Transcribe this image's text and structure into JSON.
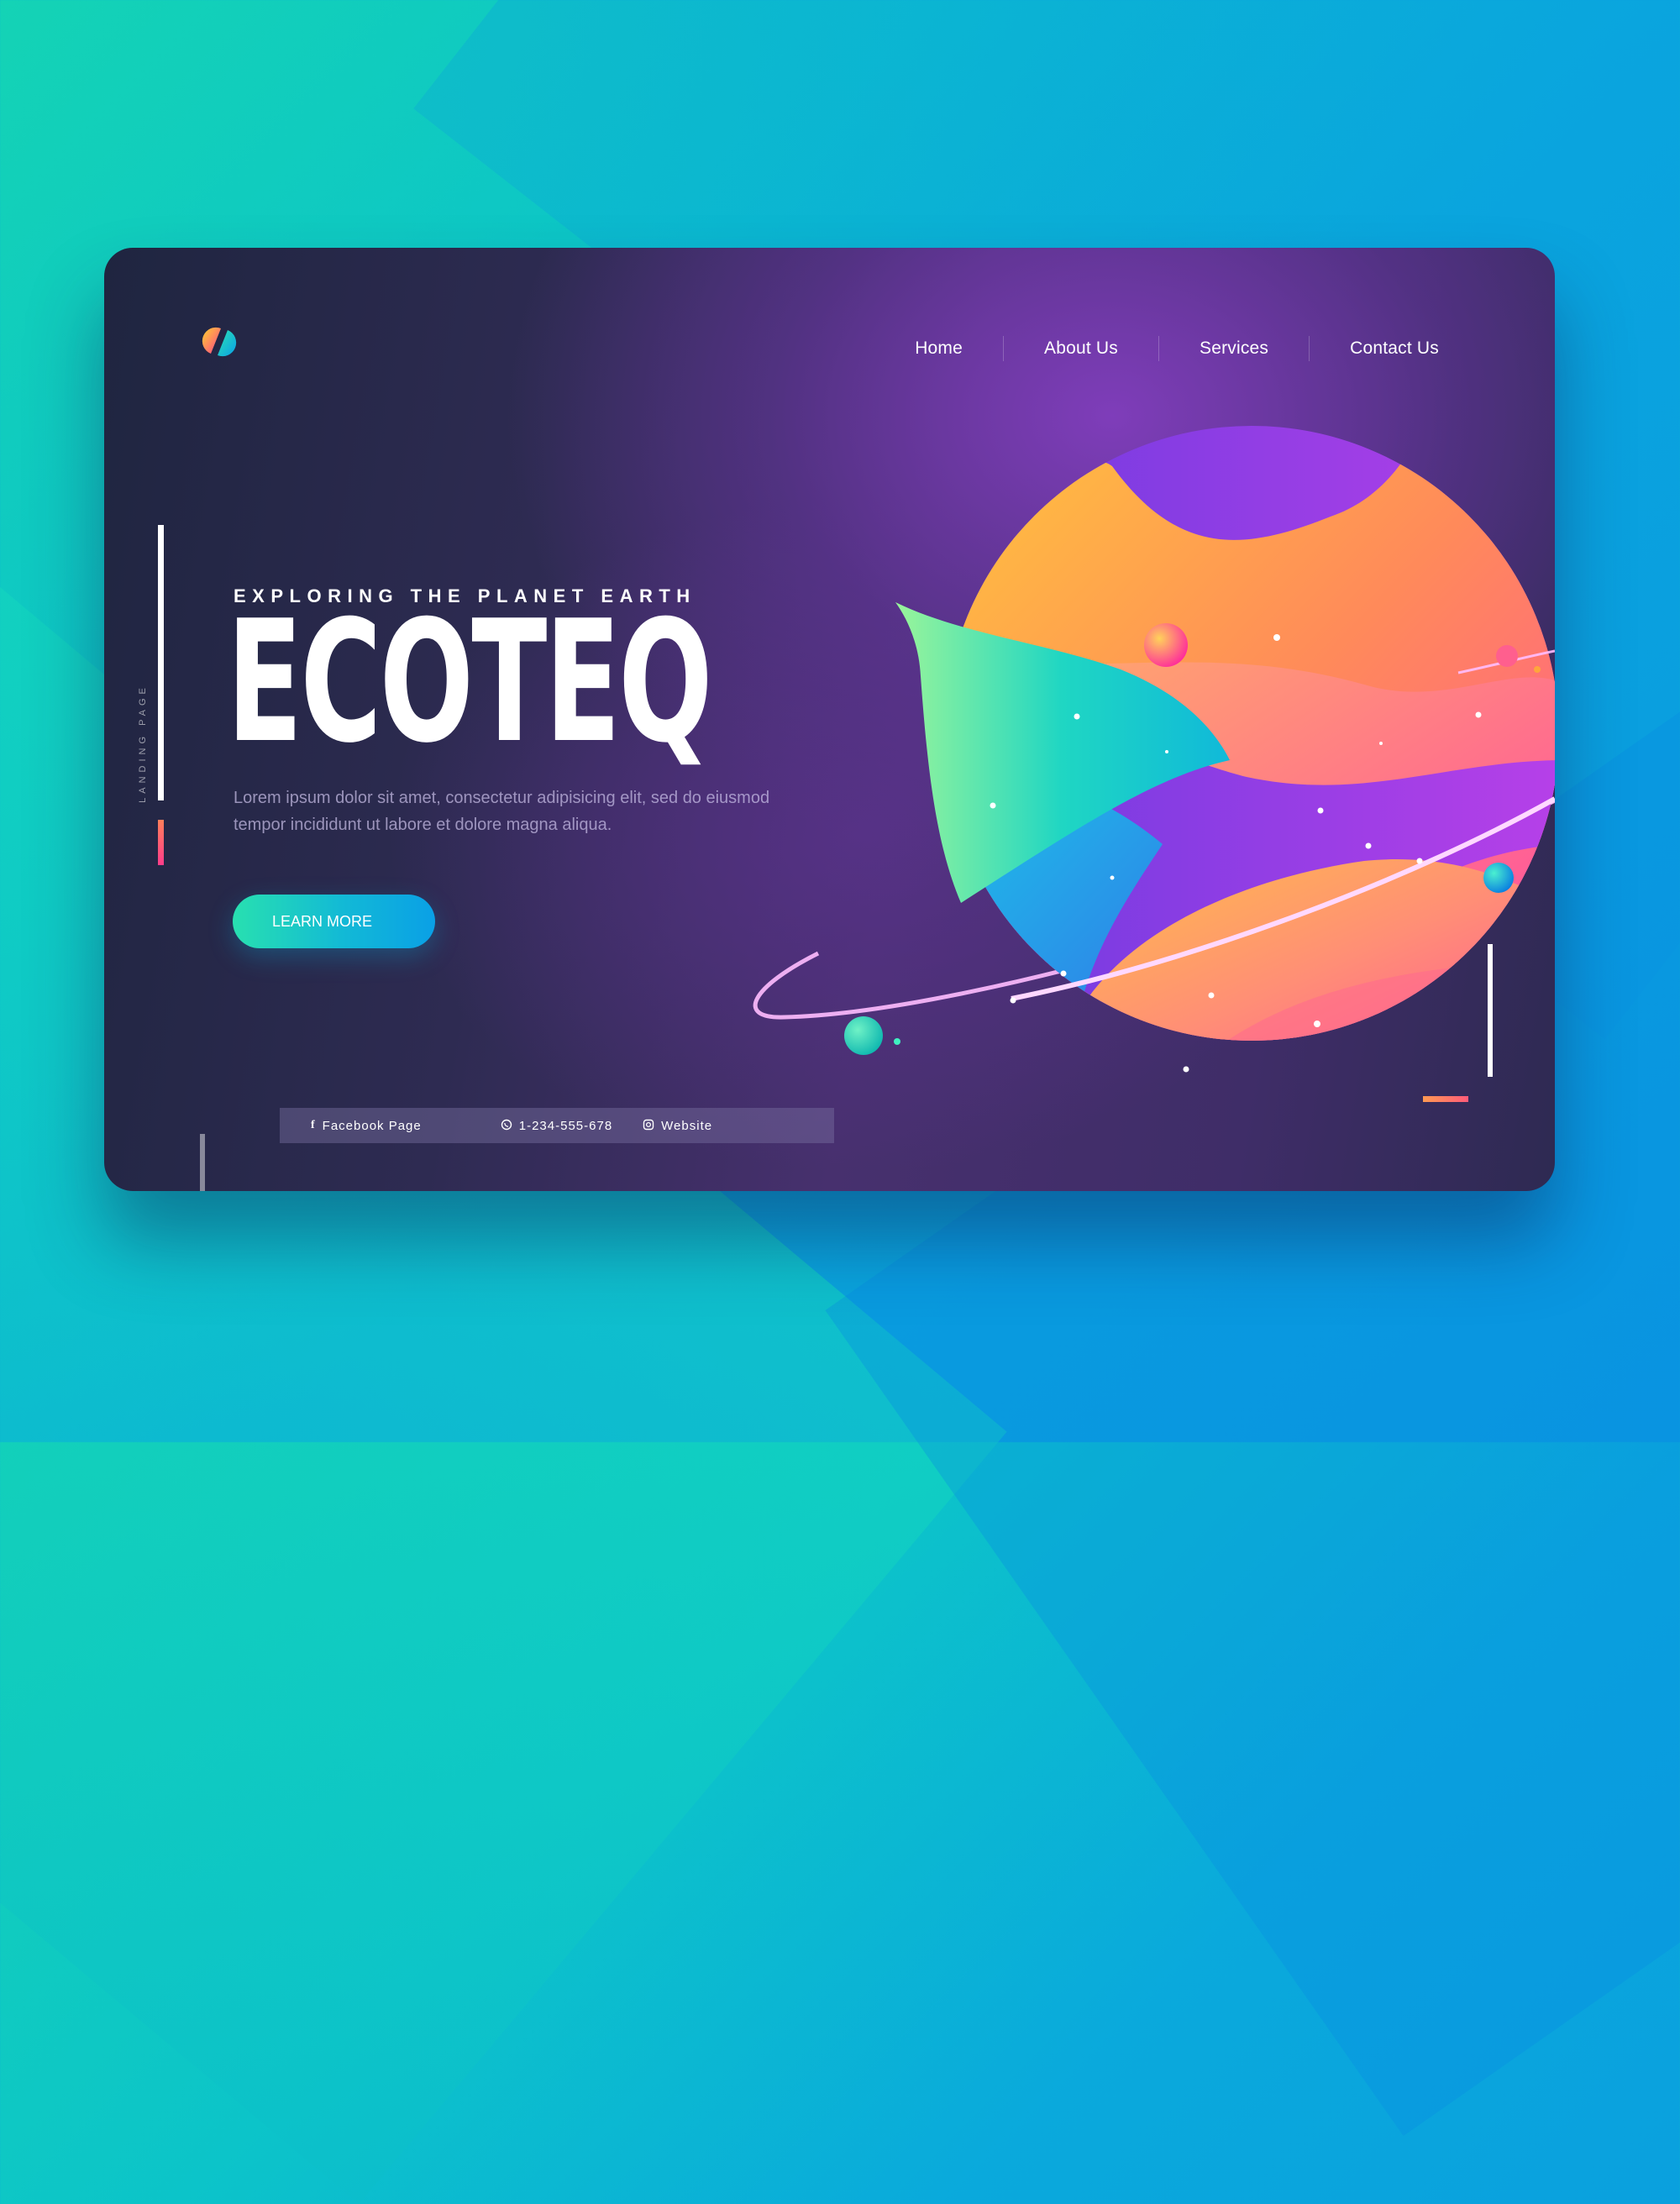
{
  "nav": {
    "items": [
      {
        "label": "Home"
      },
      {
        "label": "About Us"
      },
      {
        "label": "Services"
      },
      {
        "label": "Contact Us"
      }
    ]
  },
  "side_label": "LANDING PAGE",
  "hero": {
    "eyebrow": "EXPLORING THE PLANET EARTH",
    "title": "ECOTEQ",
    "description": "Lorem ipsum dolor sit amet, consectetur adipisicing elit, sed do eiusmod tempor incididunt ut labore et dolore magna aliqua.",
    "cta_label": "LEARN MORE"
  },
  "footer": {
    "facebook": "Facebook Page",
    "phone": "1-234-555-678",
    "website": "Website"
  },
  "icons": {
    "logo": "logo-icon",
    "facebook": "facebook-icon",
    "phone": "whatsapp-icon",
    "website": "instagram-icon"
  },
  "colors": {
    "accent_teal": "#28e0b0",
    "accent_blue": "#0aa0e6",
    "accent_pink": "#ff3d8a",
    "accent_orange": "#ff9a52",
    "card_dark": "#1f2540",
    "card_purple": "#823ebe"
  }
}
